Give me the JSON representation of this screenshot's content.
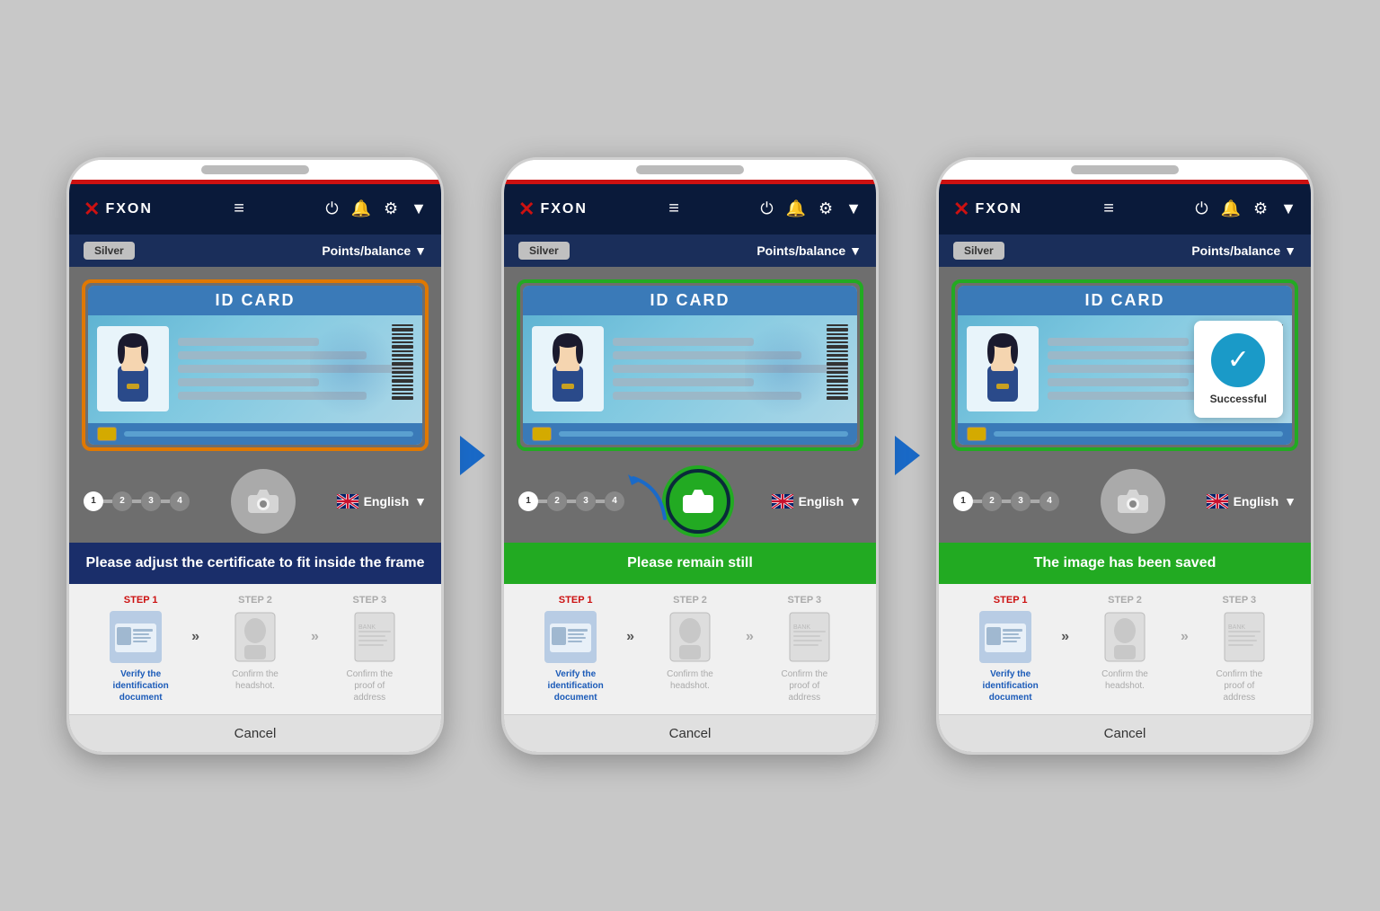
{
  "app": {
    "logo_x": "✕",
    "logo_name": "FXON",
    "silver_label": "Silver",
    "points_label": "Points/balance",
    "chevron": "▼"
  },
  "phones": [
    {
      "id": "phone1",
      "border_color": "orange",
      "id_card_title": "ID CARD",
      "status_text": "Please adjust the certificate to fit inside the frame",
      "status_color": "blue",
      "has_success": false,
      "language": "English",
      "step_active": 1,
      "steps": [
        {
          "label": "STEP 1",
          "active": true
        },
        {
          "label": "STEP 2",
          "active": false
        },
        {
          "label": "STEP 3",
          "active": false
        }
      ],
      "step_texts": [
        {
          "line1": "Verify the",
          "line2": "identification",
          "line3": "document",
          "active": true
        },
        {
          "line1": "Confirm the",
          "line2": "headshot.",
          "line3": "",
          "active": false
        },
        {
          "line1": "Confirm the",
          "line2": "proof of",
          "line3": "address",
          "active": false
        }
      ],
      "cancel_label": "Cancel"
    },
    {
      "id": "phone2",
      "border_color": "green",
      "id_card_title": "ID CARD",
      "status_text": "Please remain still",
      "status_color": "green",
      "has_success": false,
      "language": "English",
      "step_active": 1,
      "camera_active": true,
      "steps": [
        {
          "label": "STEP 1",
          "active": true
        },
        {
          "label": "STEP 2",
          "active": false
        },
        {
          "label": "STEP 3",
          "active": false
        }
      ],
      "step_texts": [
        {
          "line1": "Verify the",
          "line2": "identification",
          "line3": "document",
          "active": true
        },
        {
          "line1": "Confirm the",
          "line2": "headshot.",
          "line3": "",
          "active": false
        },
        {
          "line1": "Confirm the",
          "line2": "proof of",
          "line3": "address",
          "active": false
        }
      ],
      "cancel_label": "Cancel"
    },
    {
      "id": "phone3",
      "border_color": "green",
      "id_card_title": "ID CARD",
      "status_text": "The image has been saved",
      "status_color": "green",
      "has_success": true,
      "success_text": "Successful",
      "language": "English",
      "step_active": 1,
      "steps": [
        {
          "label": "STEP 1",
          "active": true
        },
        {
          "label": "STEP 2",
          "active": false
        },
        {
          "label": "STEP 3",
          "active": false
        }
      ],
      "step_texts": [
        {
          "line1": "Verify the",
          "line2": "identification",
          "line3": "document",
          "active": true
        },
        {
          "line1": "Confirm the",
          "line2": "headshot.",
          "line3": "",
          "active": false
        },
        {
          "line1": "Confirm the",
          "line2": "proof of",
          "line3": "address",
          "active": false
        }
      ],
      "cancel_label": "Cancel"
    }
  ]
}
